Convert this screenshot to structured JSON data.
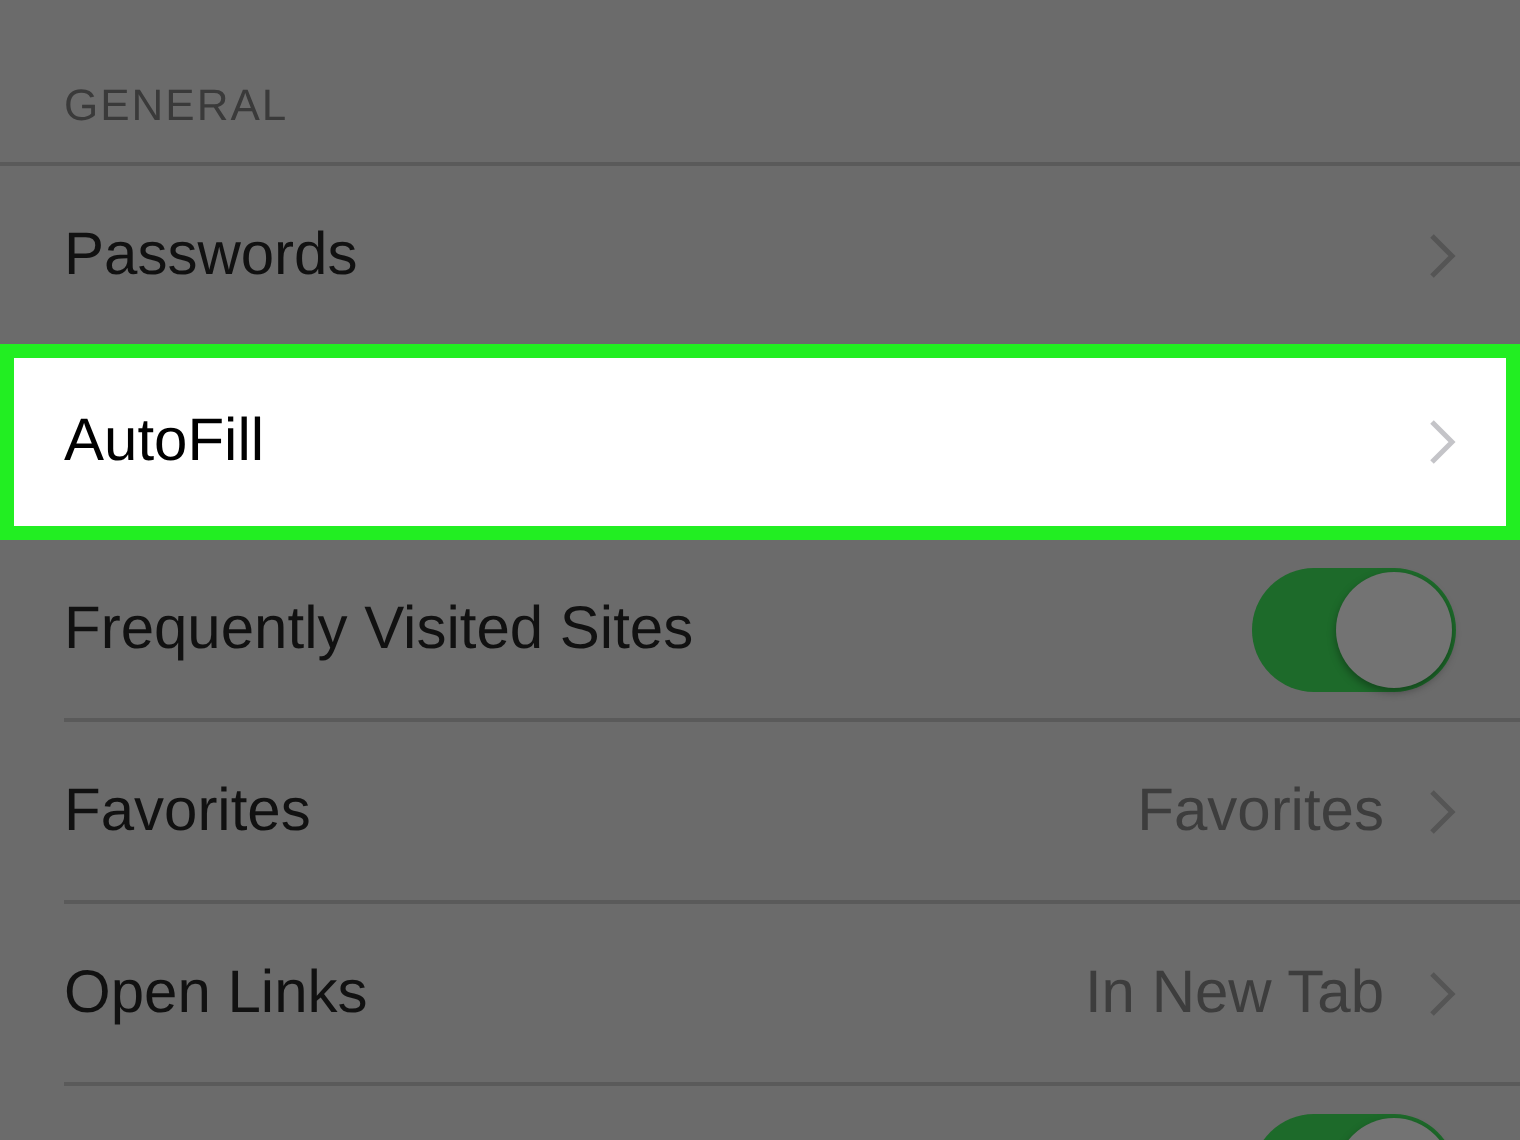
{
  "section": {
    "header": "GENERAL"
  },
  "rows": [
    {
      "kind": "link",
      "label": "Passwords",
      "highlighted": false
    },
    {
      "kind": "link",
      "label": "AutoFill",
      "highlighted": true
    },
    {
      "kind": "toggle",
      "label": "Frequently Visited Sites",
      "on": true,
      "highlighted": false
    },
    {
      "kind": "link",
      "label": "Favorites",
      "value": "Favorites",
      "highlighted": false
    },
    {
      "kind": "link",
      "label": "Open Links",
      "value": "In New Tab",
      "highlighted": false
    },
    {
      "kind": "toggle",
      "on": true,
      "highlighted": false
    }
  ]
}
